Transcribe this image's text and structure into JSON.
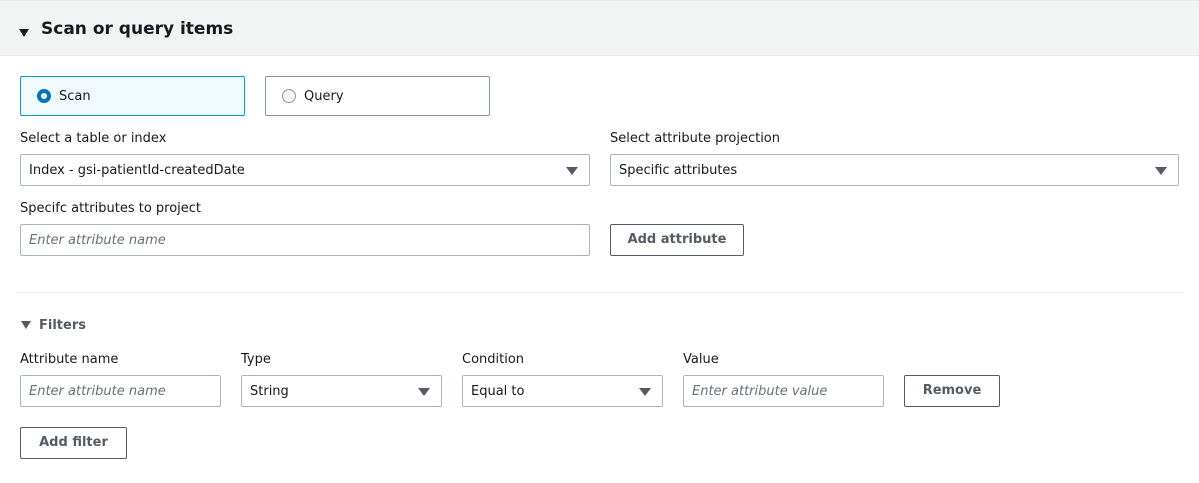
{
  "section": {
    "title": "Scan or query items"
  },
  "mode": {
    "options": [
      {
        "label": "Scan",
        "selected": true
      },
      {
        "label": "Query",
        "selected": false
      }
    ]
  },
  "table_select": {
    "label": "Select a table or index",
    "value": "Index - gsi-patientId-createdDate"
  },
  "projection_select": {
    "label": "Select attribute projection",
    "value": "Specific attributes"
  },
  "project_attributes": {
    "label": "Specifc attributes to project",
    "placeholder": "Enter attribute name",
    "add_button": "Add attribute"
  },
  "filters": {
    "title": "Filters",
    "columns": {
      "attribute_name": "Attribute name",
      "type": "Type",
      "condition": "Condition",
      "value": "Value"
    },
    "row": {
      "name_placeholder": "Enter attribute name",
      "type": "String",
      "condition": "Equal to",
      "value_placeholder": "Enter attribute value",
      "remove_button": "Remove"
    },
    "add_button": "Add filter"
  },
  "colors": {
    "accent": "#0073bb",
    "selected_bg": "#f1faff",
    "selected_border": "#00a1c9",
    "header_bg": "#f2f3f3"
  }
}
